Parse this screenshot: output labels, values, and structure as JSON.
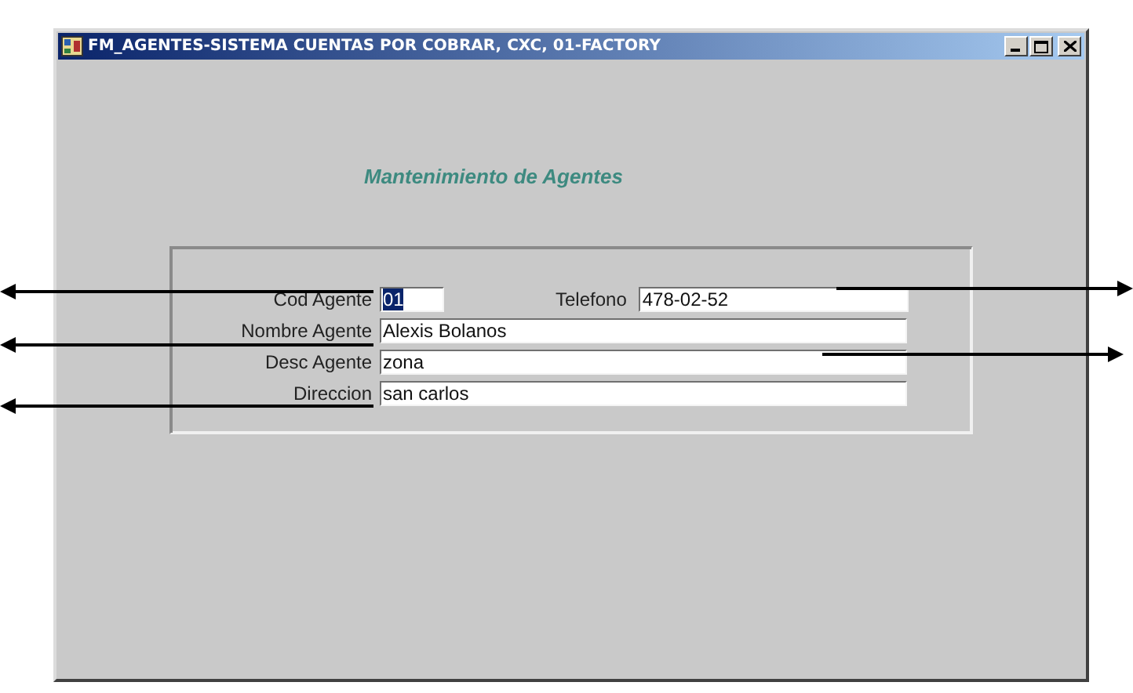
{
  "window": {
    "title": "FM_AGENTES-SISTEMA CUENTAS POR COBRAR, CXC, 01-FACTORY"
  },
  "heading": "Mantenimiento de Agentes",
  "rows": [
    [
      {
        "label": "Cod Agente",
        "value": "01",
        "highlighted": true
      },
      {
        "label": "Telefono",
        "value": "478-02-52",
        "highlighted": false
      }
    ],
    [
      {
        "label": "Nombre Agente",
        "value": "Alexis Bolanos",
        "highlighted": false
      }
    ],
    [
      {
        "label": "Desc Agente",
        "value": "zona",
        "highlighted": false
      }
    ],
    [
      {
        "label": "Direccion",
        "value": "san carlos",
        "highlighted": false
      }
    ]
  ]
}
